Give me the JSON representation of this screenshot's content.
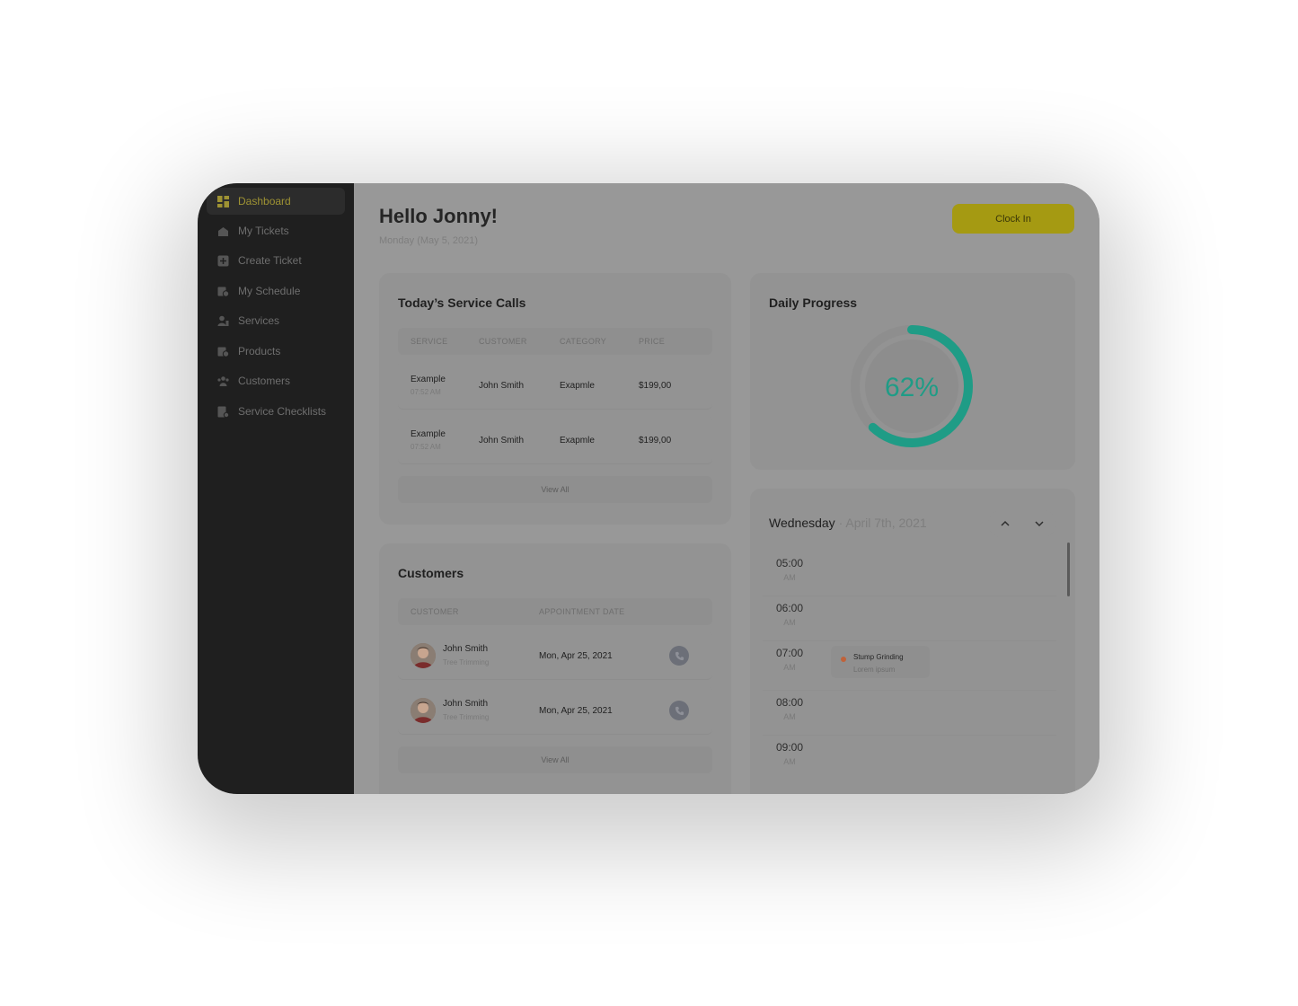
{
  "sidebar": {
    "items": [
      {
        "label": "Dashboard",
        "icon": "dashboard-icon",
        "active": true
      },
      {
        "label": "My Tickets",
        "icon": "tickets-icon"
      },
      {
        "label": "Create Ticket",
        "icon": "create-ticket-icon"
      },
      {
        "label": "My Schedule",
        "icon": "schedule-icon"
      },
      {
        "label": "Services",
        "icon": "services-icon"
      },
      {
        "label": "Products",
        "icon": "products-icon"
      },
      {
        "label": "Customers",
        "icon": "customers-icon"
      },
      {
        "label": "Service Checklists",
        "icon": "checklist-icon"
      }
    ]
  },
  "header": {
    "greeting": "Hello Jonny!",
    "date": "Monday (May 5, 2021)",
    "clock_in_label": "Clock In"
  },
  "service_calls": {
    "title": "Today’s Service Calls",
    "columns": [
      "SERVICE",
      "CUSTOMER",
      "CATEGORY",
      "PRICE"
    ],
    "rows": [
      {
        "service": "Example",
        "time": "07:52 AM",
        "customer": "John Smith",
        "category": "Exapmle",
        "price": "$199,00"
      },
      {
        "service": "Example",
        "time": "07:52 AM",
        "customer": "John Smith",
        "category": "Exapmle",
        "price": "$199,00"
      }
    ],
    "view_all": "View All"
  },
  "customers": {
    "title": "Customers",
    "columns": [
      "CUSTOMER",
      "APPOINTMENT DATE"
    ],
    "rows": [
      {
        "name": "John Smith",
        "service": "Tree Trimming",
        "date": "Mon, Apr 25, 2021"
      },
      {
        "name": "John Smith",
        "service": "Tree Trimming",
        "date": "Mon, Apr 25, 2021"
      }
    ],
    "view_all": "View All"
  },
  "progress": {
    "title": "Daily Progress",
    "value_label": "62%",
    "value": 0.62,
    "color": "#1f9c86"
  },
  "schedule": {
    "day": "Wednesday",
    "date": "· April 7th, 2021",
    "slots": [
      {
        "time": "05:00",
        "ampm": "AM"
      },
      {
        "time": "06:00",
        "ampm": "AM"
      },
      {
        "time": "07:00",
        "ampm": "AM"
      },
      {
        "time": "08:00",
        "ampm": "AM"
      },
      {
        "time": "09:00",
        "ampm": "AM"
      }
    ],
    "event": {
      "title": "Stump Grinding",
      "subtitle": "Lorem ipsum",
      "dot_color": "#c0623a"
    }
  },
  "colors": {
    "accent": "#a59a12",
    "sidebar": "#1f1f1f"
  }
}
